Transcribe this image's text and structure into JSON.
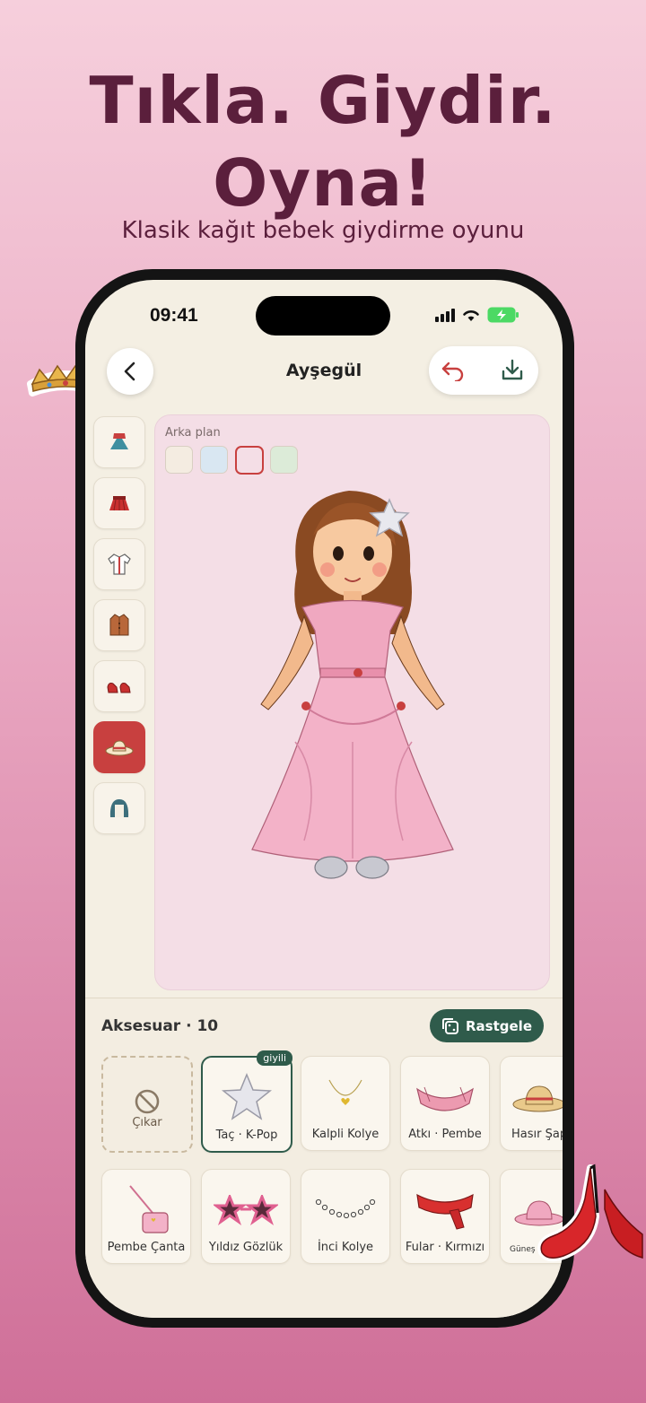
{
  "headline": {
    "line1": "Tıkla. Giydir.",
    "line2": "Oyna!",
    "subtitle": "Klasik kağıt bebek giydirme oyunu"
  },
  "status_bar": {
    "time": "09:41"
  },
  "header": {
    "title": "Ayşegül"
  },
  "categories": [
    {
      "icon": "dress-icon",
      "active": false
    },
    {
      "icon": "skirt-icon",
      "active": false
    },
    {
      "icon": "shirt-icon",
      "active": false
    },
    {
      "icon": "coat-icon",
      "active": false
    },
    {
      "icon": "shoes-icon",
      "active": false
    },
    {
      "icon": "hat-icon",
      "active": true
    },
    {
      "icon": "hair-icon",
      "active": false
    }
  ],
  "canvas": {
    "background_label": "Arka plan",
    "swatches": [
      {
        "color": "#f4ece1",
        "selected": false
      },
      {
        "color": "#d9e7f2",
        "selected": false
      },
      {
        "color": "#f4dee6",
        "selected": true
      },
      {
        "color": "#dcebd8",
        "selected": false
      }
    ]
  },
  "accessories": {
    "title": "Aksesuar · 10",
    "random_label": "Rastgele",
    "remove_label": "Çıkar",
    "worn_badge": "giyili",
    "items": [
      {
        "label": "Taç · K-Pop",
        "icon": "star-crown-icon",
        "worn": true
      },
      {
        "label": "Kalpli Kolye",
        "icon": "heart-necklace-icon",
        "worn": false
      },
      {
        "label": "Atkı · Pembe",
        "icon": "pink-scarf-icon",
        "worn": false
      },
      {
        "label": "Hasır Şapka",
        "icon": "straw-hat-icon",
        "worn": false
      },
      {
        "label": "Pembe Çanta",
        "icon": "pink-bag-icon",
        "worn": false
      },
      {
        "label": "Yıldız Gözlük",
        "icon": "star-glasses-icon",
        "worn": false
      },
      {
        "label": "İnci Kolye",
        "icon": "pearl-necklace-icon",
        "worn": false
      },
      {
        "label": "Fular · Kırmızı",
        "icon": "red-scarf-icon",
        "worn": false
      },
      {
        "label": "Güneş Şapkası",
        "icon": "sun-hat-icon",
        "worn": false
      }
    ]
  },
  "colors": {
    "accent_green": "#2f5b4b",
    "accent_red": "#c8403f",
    "headline": "#5b1f3c"
  }
}
